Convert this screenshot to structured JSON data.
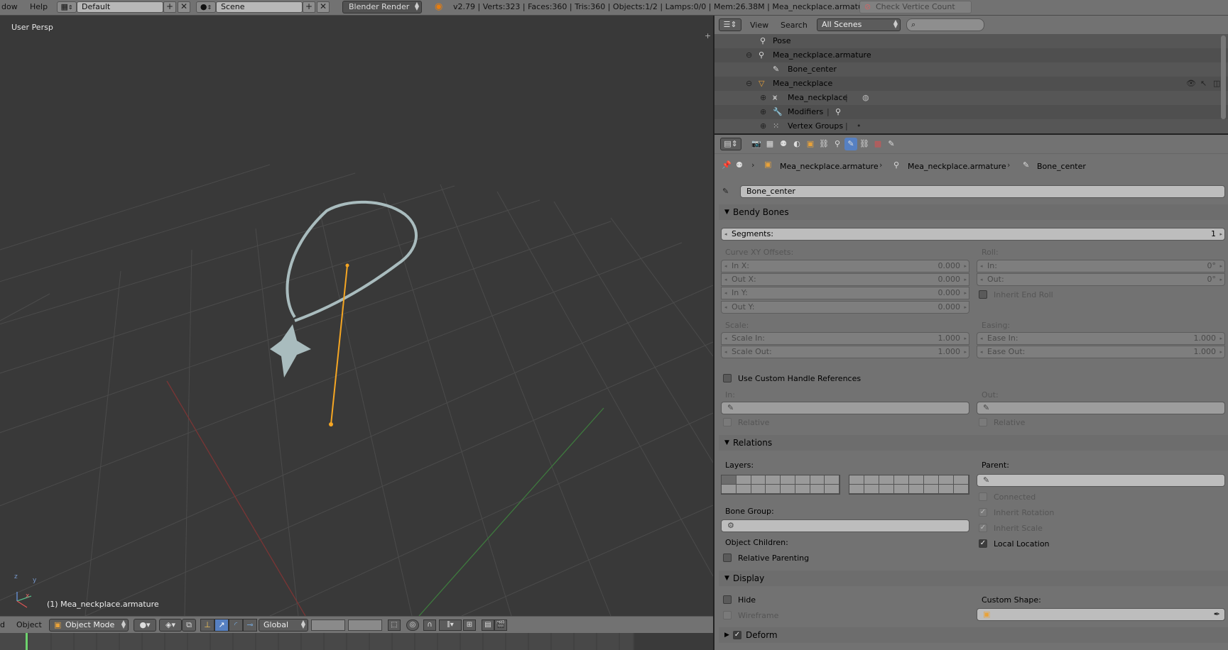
{
  "topbar": {
    "menus": [
      "dow",
      "Help"
    ],
    "layout": "Default",
    "scene": "Scene",
    "engine": "Blender Render",
    "stats": "v2.79 | Verts:323 | Faces:360 | Tris:360 | Objects:1/2 | Lamps:0/0 | Mem:26.38M | Mea_neckplace.armature",
    "check_button": "Check Vertice Count"
  },
  "viewport": {
    "view_label": "User Persp",
    "object_label": "(1) Mea_neckplace.armature",
    "axes": {
      "x": "x",
      "y": "y",
      "z": "z"
    }
  },
  "viewport_toolbar": {
    "menu_partial": "d",
    "object_menu": "Object",
    "mode": "Object Mode",
    "orientation": "Global"
  },
  "outliner": {
    "view": "View",
    "search": "Search",
    "filter": "All Scenes",
    "rows": [
      {
        "label": "Pose"
      },
      {
        "label": "Mea_neckplace.armature"
      },
      {
        "label": "Bone_center"
      },
      {
        "label": "Mea_neckplace"
      },
      {
        "label": "Mea_neckplace"
      },
      {
        "label": "Modifiers"
      },
      {
        "label": "Vertex Groups"
      }
    ]
  },
  "breadcrumb": {
    "item1": "Mea_neckplace.armature",
    "item2": "Mea_neckplace.armature",
    "item3": "Bone_center"
  },
  "bone_name": "Bone_center",
  "bendy": {
    "title": "Bendy Bones",
    "segments_label": "Segments:",
    "segments_value": "1",
    "curve_label": "Curve XY Offsets:",
    "in_x_label": "In X:",
    "in_x": "0.000",
    "out_x_label": "Out X:",
    "out_x": "0.000",
    "in_y_label": "In Y:",
    "in_y": "0.000",
    "out_y_label": "Out Y:",
    "out_y": "0.000",
    "roll_label": "Roll:",
    "roll_in_label": "In:",
    "roll_in": "0°",
    "roll_out_label": "Out:",
    "roll_out": "0°",
    "inherit_end_roll": "Inherit End Roll",
    "scale_label": "Scale:",
    "scale_in_label": "Scale In:",
    "scale_in": "1.000",
    "scale_out_label": "Scale Out:",
    "scale_out": "1.000",
    "easing_label": "Easing:",
    "ease_in_label": "Ease In:",
    "ease_in": "1.000",
    "ease_out_label": "Ease Out:",
    "ease_out": "1.000",
    "custom_handle": "Use Custom Handle References",
    "in_label": "In:",
    "out_label": "Out:",
    "relative": "Relative"
  },
  "relations": {
    "title": "Relations",
    "layers_label": "Layers:",
    "parent_label": "Parent:",
    "connected": "Connected",
    "inherit_rotation": "Inherit Rotation",
    "inherit_scale": "Inherit Scale",
    "local_location": "Local Location",
    "bone_group_label": "Bone Group:",
    "object_children_label": "Object Children:",
    "relative_parenting": "Relative Parenting"
  },
  "display": {
    "title": "Display",
    "hide": "Hide",
    "wireframe": "Wireframe",
    "custom_shape_label": "Custom Shape:"
  },
  "deform": {
    "title": "Deform"
  },
  "colors": {
    "accent": "#5680c2",
    "bone": "#f5a623",
    "grid_x": "#8a3434",
    "grid_y": "#3f7a3f"
  }
}
